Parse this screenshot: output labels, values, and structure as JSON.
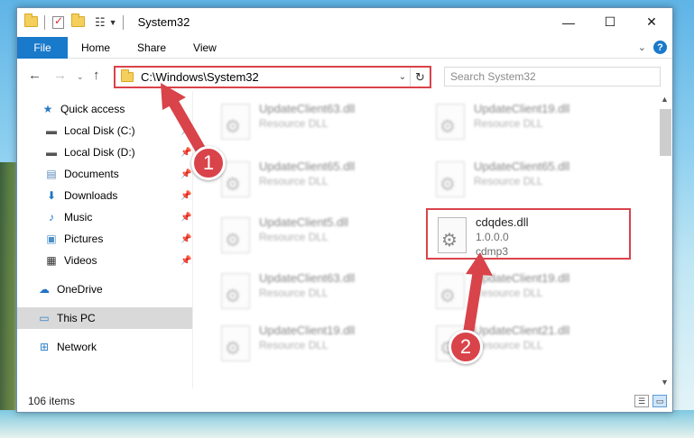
{
  "window": {
    "title": "System32",
    "controls": {
      "minimize": "—",
      "maximize": "☐",
      "close": "✕"
    }
  },
  "ribbon": {
    "file": "File",
    "tabs": [
      "Home",
      "Share",
      "View"
    ],
    "help": "?"
  },
  "address": {
    "path": "C:\\Windows\\System32",
    "search_placeholder": "Search System32"
  },
  "navpane": {
    "items": [
      {
        "label": "Quick access",
        "icon": "star-icon",
        "pinned": false
      },
      {
        "label": "Local Disk (C:)",
        "icon": "drive-icon",
        "pinned": true
      },
      {
        "label": "Local Disk (D:)",
        "icon": "drive-icon",
        "pinned": true
      },
      {
        "label": "Documents",
        "icon": "documents-icon",
        "pinned": true
      },
      {
        "label": "Downloads",
        "icon": "download-icon",
        "pinned": true
      },
      {
        "label": "Music",
        "icon": "music-icon",
        "pinned": true
      },
      {
        "label": "Pictures",
        "icon": "pictures-icon",
        "pinned": true
      },
      {
        "label": "Videos",
        "icon": "videos-icon",
        "pinned": true
      },
      {
        "label": "OneDrive",
        "icon": "cloud-icon",
        "pinned": false
      },
      {
        "label": "This PC",
        "icon": "computer-icon",
        "pinned": false,
        "selected": true
      },
      {
        "label": "Network",
        "icon": "network-icon",
        "pinned": false
      }
    ]
  },
  "files": [
    {
      "name": "UpdateClient63.dll",
      "type": "Resource DLL"
    },
    {
      "name": "UpdateClient19.dll",
      "type": "Resource DLL"
    },
    {
      "name": "UpdateClient65.dll",
      "type": "Resource DLL"
    },
    {
      "name": "UpdateClient65.dll",
      "type": "Resource DLL"
    },
    {
      "name": "UpdateClient5.dll",
      "type": "Resource DLL"
    },
    {
      "name": "cdqdes.dll",
      "version": "1.0.0.0",
      "company": "cdmp3",
      "highlighted": true
    },
    {
      "name": "UpdateClient63.dll",
      "type": "Resource DLL"
    },
    {
      "name": "UpdateClient19.dll",
      "type": "Resource DLL"
    },
    {
      "name": "UpdateClient19.dll",
      "type": "Resource DLL"
    },
    {
      "name": "UpdateClient21.dll",
      "type": "Resource DLL"
    }
  ],
  "status": {
    "item_count": "106 items"
  },
  "annotations": {
    "badge1": "1",
    "badge2": "2",
    "color": "#d9434a"
  }
}
